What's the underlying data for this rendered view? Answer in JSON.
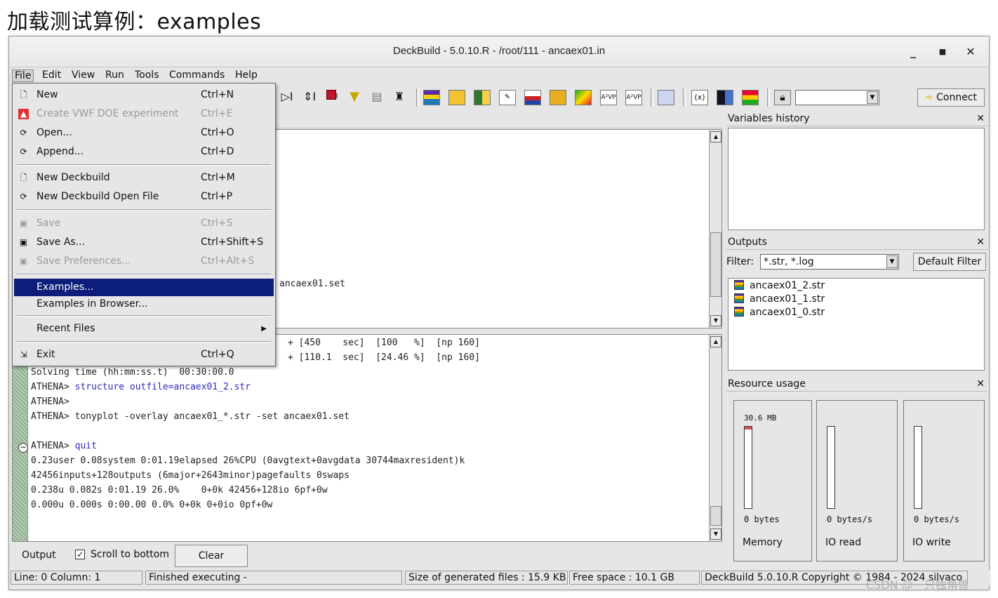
{
  "page_heading": "加载测试算例：examples",
  "window": {
    "title": "DeckBuild - 5.0.10.R - /root/111 - ancaex01.in",
    "minimize": "_",
    "maximize": "■",
    "close": "✕"
  },
  "menubar": [
    "File",
    "Edit",
    "View",
    "Run",
    "Tools",
    "Commands",
    "Help"
  ],
  "file_menu": {
    "items": [
      {
        "label": "New",
        "shortcut": "Ctrl+N",
        "icon": "new-file-icon",
        "disabled": false
      },
      {
        "label": "Create VWF DOE experiment",
        "shortcut": "Ctrl+E",
        "icon": "vwf-experiment-icon",
        "disabled": true
      },
      {
        "label": "Open...",
        "shortcut": "Ctrl+O",
        "icon": "open-icon",
        "disabled": false
      },
      {
        "label": "Append...",
        "shortcut": "Ctrl+D",
        "icon": "append-icon",
        "disabled": false
      },
      {
        "label": "New Deckbuild",
        "shortcut": "Ctrl+M",
        "icon": "new-deckbuild-icon",
        "disabled": false
      },
      {
        "label": "New Deckbuild Open File",
        "shortcut": "Ctrl+P",
        "icon": "open-deckbuild-icon",
        "disabled": false
      },
      {
        "label": "Save",
        "shortcut": "Ctrl+S",
        "icon": "save-icon",
        "disabled": true
      },
      {
        "label": "Save As...",
        "shortcut": "Ctrl+Shift+S",
        "icon": "save-as-icon",
        "disabled": false
      },
      {
        "label": "Save Preferences...",
        "shortcut": "Ctrl+Alt+S",
        "icon": "save-preferences-icon",
        "disabled": true
      },
      {
        "label": "Examples...",
        "shortcut": "",
        "icon": "",
        "disabled": false,
        "selected": true
      },
      {
        "label": "Examples in Browser...",
        "shortcut": "",
        "icon": "",
        "disabled": false
      },
      {
        "label": "Recent Files",
        "shortcut": "",
        "icon": "",
        "disabled": false,
        "submenu": true
      },
      {
        "label": "Exit",
        "shortcut": "Ctrl+Q",
        "icon": "exit-icon",
        "disabled": false
      }
    ]
  },
  "toolbar": {
    "connect_label": "Connect",
    "host_combo_value": ""
  },
  "editor": {
    "visible_text": "ancaex01.set"
  },
  "console": {
    "top_lines": [
      "+ [450    sec]  [100   %]  [np 160]",
      "+ [110.1  sec]  [24.46 %]  [np 160]"
    ],
    "lines": [
      {
        "text": "Solving time (hh:mm:ss.t)  00:30:00.0",
        "cmd": false
      },
      {
        "text": "ATHENA> ",
        "cmd_text": "structure outfile=ancaex01_2.str"
      },
      {
        "text": "ATHENA>",
        "cmd_text": ""
      },
      {
        "text": "ATHENA> tonyplot -overlay ancaex01_*.str -set ancaex01.set",
        "cmd_text": ""
      },
      {
        "text": "",
        "cmd_text": ""
      },
      {
        "text": "ATHENA> ",
        "cmd_text": "quit"
      },
      {
        "text": "0.23user 0.08system 0:01.19elapsed 26%CPU (0avgtext+0avgdata 30744maxresident)k",
        "cmd_text": ""
      },
      {
        "text": "42456inputs+128outputs (6major+2643minor)pagefaults 0swaps",
        "cmd_text": ""
      },
      {
        "text": "0.238u 0.082s 0:01.19 26.0%    0+0k 42456+128io 6pf+0w",
        "cmd_text": ""
      },
      {
        "text": "0.000u 0.000s 0:00.00 0.0% 0+0k 0+0io 0pf+0w",
        "cmd_text": ""
      }
    ],
    "tab_output": "Output",
    "scroll_to_bottom_label": "Scroll to bottom",
    "scroll_to_bottom_checked": true,
    "clear_label": "Clear"
  },
  "variables_history": {
    "title": "Variables history",
    "close": "✕"
  },
  "outputs": {
    "title": "Outputs",
    "close": "✕",
    "filter_label": "Filter:",
    "filter_value": "*.str, *.log",
    "default_filter_label": "Default Filter",
    "files": [
      "ancaex01_2.str",
      "ancaex01_1.str",
      "ancaex01_0.str"
    ]
  },
  "resource_usage": {
    "title": "Resource usage",
    "close": "✕",
    "meters": [
      {
        "name": "Memory",
        "value": "0 bytes",
        "top_label": "30.6 MB"
      },
      {
        "name": "IO read",
        "value": "0 bytes/s",
        "top_label": ""
      },
      {
        "name": "IO write",
        "value": "0 bytes/s",
        "top_label": ""
      }
    ]
  },
  "status_bar": {
    "position": "Line: 0 Column: 1",
    "state": "Finished executing -",
    "generated_size": "Size of generated files : 15.9 KB",
    "free_space": "Free space : 10.1 GB",
    "version": "DeckBuild 5.0.10.R  Copyright © 1984 - 2024 silvaco"
  },
  "watermark": "CSDN @一只独角兽"
}
